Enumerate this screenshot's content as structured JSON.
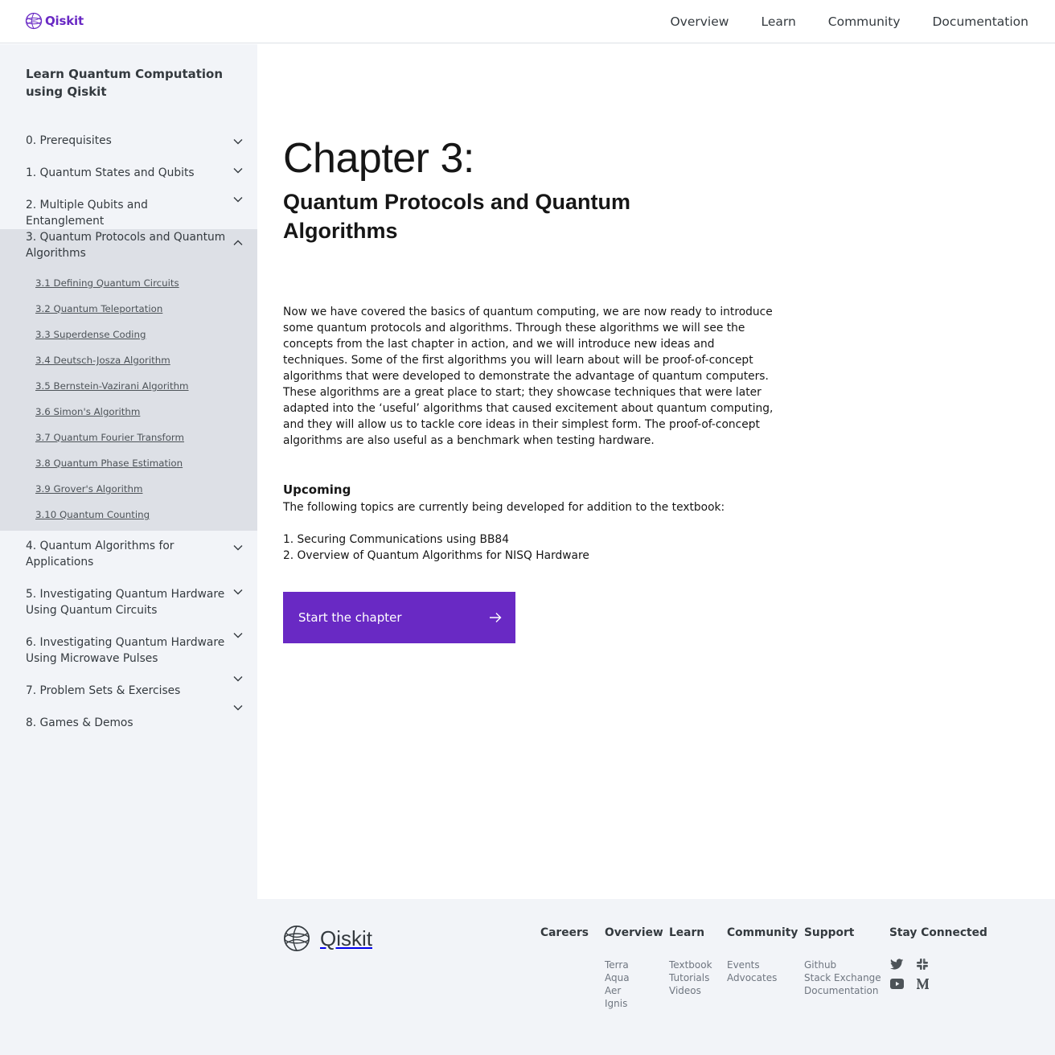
{
  "header": {
    "brand": "Qiskit",
    "nav": [
      "Overview",
      "Learn",
      "Community",
      "Documentation"
    ]
  },
  "sidebar": {
    "title": "Learn Quantum Computation using Qiskit",
    "items": [
      {
        "label": "0. Prerequisites",
        "expanded": false
      },
      {
        "label": "1. Quantum States and Qubits",
        "expanded": false
      },
      {
        "label": "2. Multiple Qubits and Entanglement",
        "expanded": false
      },
      {
        "label": "3. Quantum Protocols and Quantum Algorithms",
        "expanded": true,
        "children": [
          "3.1 Defining Quantum Circuits",
          "3.2 Quantum Teleportation",
          "3.3 Superdense Coding",
          "3.4 Deutsch-Josza Algorithm",
          "3.5 Bernstein-Vazirani Algorithm",
          "3.6 Simon's Algorithm",
          "3.7 Quantum Fourier Transform",
          "3.8 Quantum Phase Estimation",
          "3.9 Grover's Algorithm",
          "3.10 Quantum Counting"
        ]
      },
      {
        "label": "4. Quantum Algorithms for Applications",
        "expanded": false
      },
      {
        "label": "5. Investigating Quantum Hardware Using Quantum Circuits",
        "expanded": false
      },
      {
        "label": "6. Investigating Quantum Hardware Using Microwave Pulses",
        "expanded": false
      },
      {
        "label": "7. Problem Sets & Exercises",
        "expanded": false
      },
      {
        "label": "8. Games & Demos",
        "expanded": false
      }
    ]
  },
  "main": {
    "chapter_number": "Chapter 3:",
    "chapter_title": "Quantum Protocols and Quantum Algorithms",
    "intro": "Now we have covered the basics of quantum computing, we are now ready to introduce some quantum protocols and algorithms. Through these algorithms we will see the concepts from the last chapter in action, and we will introduce new ideas and techniques. Some of the first algorithms you will learn about will be proof-of-concept algorithms that were developed to demonstrate the advantage of quantum computers. These algorithms are a great place to start; they showcase techniques that were later adapted into the ‘useful’ algorithms that caused excitement about quantum computing, and they will allow us to tackle core ideas in their simplest form. The proof-of-concept algorithms are also useful as a benchmark when testing hardware.",
    "upcoming_heading": "Upcoming",
    "upcoming_text": "The following topics are currently being developed for addition to the textbook:",
    "upcoming_items": [
      "1. Securing Communications using BB84",
      "2. Overview of Quantum Algorithms for NISQ Hardware"
    ],
    "cta_label": "Start the chapter"
  },
  "footer": {
    "brand": "Qiskit",
    "columns": [
      {
        "heading": "Careers",
        "links": []
      },
      {
        "heading": "Overview",
        "links": [
          "Terra",
          "Aqua",
          "Aer",
          "Ignis"
        ]
      },
      {
        "heading": "Learn",
        "links": [
          "Textbook",
          "Tutorials",
          "Videos"
        ]
      },
      {
        "heading": "Community",
        "links": [
          "Events",
          "Advocates"
        ]
      },
      {
        "heading": "Support",
        "links": [
          "Github",
          "Stack Exchange",
          "Documentation"
        ]
      },
      {
        "heading": "Stay Connected",
        "links": []
      }
    ],
    "social_icons": [
      "twitter-icon",
      "slack-icon",
      "youtube-icon",
      "medium-icon"
    ]
  },
  "colors": {
    "brand_purple": "#6929c4",
    "sidebar_bg": "#f2f4f8",
    "sidebar_active_bg": "#dde0e6",
    "footer_bg": "#f2f4f8"
  }
}
